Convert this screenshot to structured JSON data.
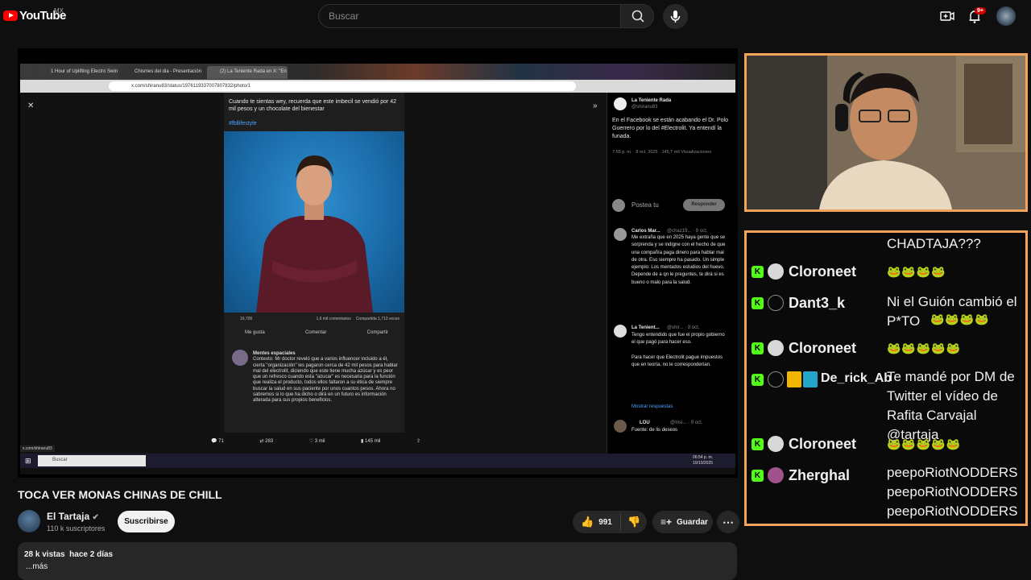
{
  "masthead": {
    "logo_text": "YouTube",
    "country": "MX",
    "search_placeholder": "Buscar",
    "notifications_badge": "9+"
  },
  "player": {
    "browser_tabs": [
      "1 Hour of Uplifting Electro Swin",
      "Chismes del dia - Presentación",
      "(2) La Teniente Rada en X: \"En e"
    ],
    "url": "x.com/shiranu83/status/1976119337007807832/photo/1",
    "post_text": "Cuando te sientas wey, recuerda que este imbecil se vendió por 42 mil pesos y un chocolate del bienestar",
    "hashtag": "#fbllifestyle",
    "fb_reactions": "16,700",
    "fb_comments": "1,6 mil comentarios",
    "fb_shares": "Compartida 1,713 veces",
    "fb_like": "Me gusta",
    "fb_comment": "Comentar",
    "fb_share": "Compartir",
    "comment_author": "Mentes espaciales",
    "comment_body": "Contexto: Mr doctor reveló que a varios influencer incluido a él, cierta \"organización\" les pagaron cerca de 42 mil pesos para hablar mal del electrolit, diciendo que este tiene mucha azúcar y es peor que un refresco cuando esta \"azucar\" es necesaria para la función que realiza el producto, todos ellos faltaron a su ética de siempre buscar la salud en sus paciente por unos cuantos pesos. Ahora no sabremos si lo que ha dicho o dirá en un futuro es información alterada para sus propios beneficios.",
    "x_replies": "71",
    "x_retweets": "283",
    "x_likes": "3 mil",
    "x_views": "145 mil",
    "tweet_author": "La Teniente Rada",
    "tweet_handle": "@shiranu83",
    "tweet_text": "En el Facebook se están acabando el Dr. Polo Guerrero por lo del #Electrolit. Ya entendí la funada.",
    "tweet_time": "7:55 p. m. · 8 oct. 2025 · 145,7 mil Visualizaciones",
    "post_reply_placeholder": "Postea tu",
    "reply_button": "Responder",
    "reply1_author": "Carlos Mar...",
    "reply1_meta": "@chaz19... · 9 oct.",
    "reply1_text": "Me extraña que en 2025 haya gente que se sorprenda y se indigne con el hecho de que una compañía paga dinero para hablar mal de otra. Eso siempre ha pasado. Un simple ejemplo: Los mentados estudios del huevo. Depende de a qn le preguntes, te dirá si es bueno o malo para la salud.",
    "reply2_author": "La Tenient...",
    "reply2_meta": "@shir... · 9 oct.",
    "reply2_text": "Tengo entendido que fue el propio gobierno el que pagó para hacer eso.\n\nPara hacer que Electrolit pague impuestos que en teoría, no le corresponderían.",
    "show_replies": "Mostrar respuestas",
    "reply3_author": "LOU",
    "reply3_meta": "@Insi... · 9 oct.",
    "reply3_text": "Fuente: de lis deseos",
    "status_link": "x.com/shiranu83",
    "taskbar_search": "Buscar",
    "clock_time": "06:54 p. m.",
    "clock_date": "10/10/2025"
  },
  "video": {
    "title": "TOCA VER MONAS CHINAS DE CHILL",
    "channel": "El Tartaja",
    "subscribers": "110 k suscriptores",
    "subscribe_label": "Suscribirse",
    "likes": "991",
    "save_label": "Guardar",
    "views": "28 k vistas",
    "age": "hace 2 días",
    "more": "...más"
  },
  "chat": {
    "top_text": "CHADTAJA???",
    "messages": [
      {
        "user": "Cloroneet",
        "text": "",
        "emotes": "🐸🐸🐸🐸"
      },
      {
        "user": "Dant3_k",
        "text": "Ni el Guión cambió el P*TO",
        "emotes": "🐸🐸🐸🐸"
      },
      {
        "user": "Cloroneet",
        "text": "",
        "emotes": "🐸🐸🐸🐸🐸"
      },
      {
        "user": "De_rick_Ab",
        "text": "Te mandé por DM de Twitter el vídeo de Rafita Carvajal @tartaja",
        "emotes": ""
      },
      {
        "user": "Cloroneet",
        "text": "",
        "emotes": "🐸🐸🐸🐸🐸"
      },
      {
        "user": "Zherghal",
        "text": "peepoRiotNODDERSpeepoRiotNODDERSpeepoRiotNODDERS",
        "emotes": ""
      }
    ]
  },
  "colors": {
    "accent_border": "#f4a35a",
    "kick_green": "#53fc18",
    "youtube_red": "#ff0000"
  }
}
